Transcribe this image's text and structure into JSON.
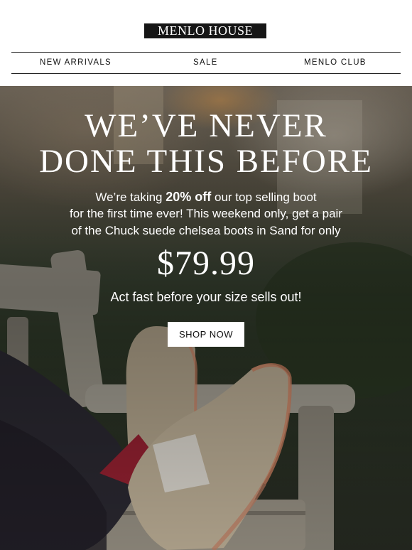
{
  "brand": {
    "logo_text": "MENLO HOUSE"
  },
  "nav": {
    "items": [
      {
        "label": "NEW ARRIVALS"
      },
      {
        "label": "SALE"
      },
      {
        "label": "MENLO CLUB"
      }
    ]
  },
  "hero": {
    "headline_line1": "WE’VE NEVER",
    "headline_line2": "DONE THIS BEFORE",
    "body_line1_pre": "We’re taking ",
    "body_line1_bold": "20% off",
    "body_line1_post": " our top selling boot",
    "body_line2": "for the first time ever! This weekend only, get a pair",
    "body_line3": "of the Chuck suede chelsea boots in Sand for only",
    "price": "$79.99",
    "urgency": "Act fast before your size sells out!",
    "cta_label": "SHOP NOW"
  },
  "colors": {
    "logo_bg": "#161616",
    "cta_bg": "#ffffff",
    "hero_text": "#ffffff",
    "boot_suede": "#b1a48d",
    "sock": "#8c1f2e",
    "bench_wood": "#8c877d"
  }
}
